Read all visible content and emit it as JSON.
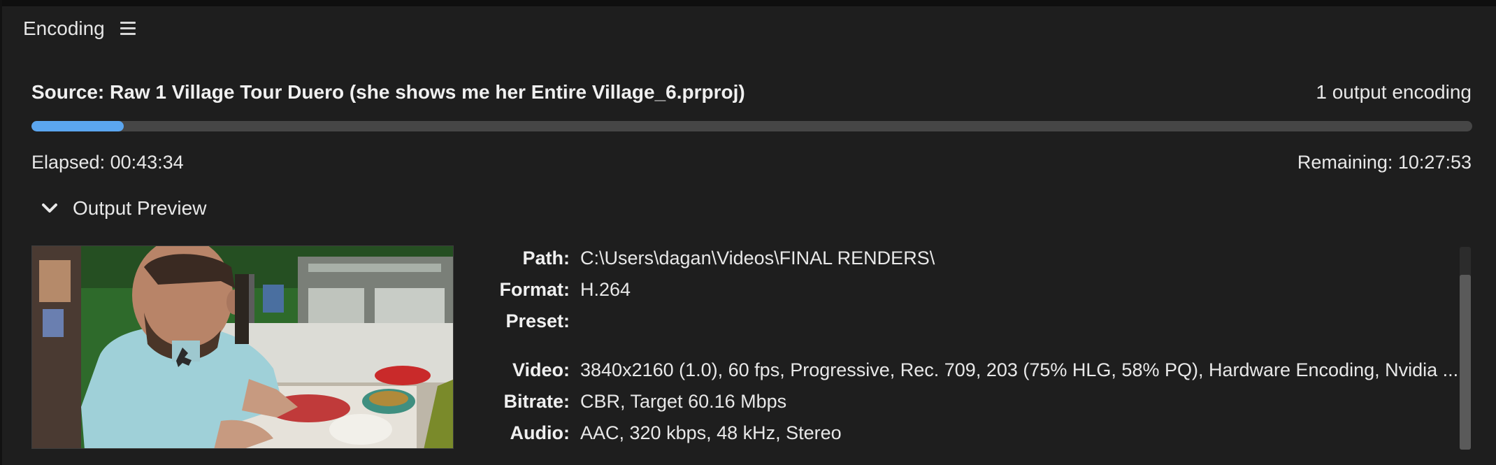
{
  "panel": {
    "tab_label": "Encoding",
    "menu_icon": "hamburger-menu-icon"
  },
  "encoding": {
    "source_label": "Source: Raw 1 Village Tour Duero (she shows me her Entire Village_6.prproj)",
    "output_count": "1 output encoding",
    "progress_fraction": 0.064,
    "progress_color": "#5ba6f0",
    "elapsed": "Elapsed: 00:43:34",
    "remaining": "Remaining: 10:27:53"
  },
  "preview": {
    "toggle_label": "Output Preview",
    "toggle_icon": "chevron-down-icon",
    "expanded": true
  },
  "output_info": {
    "path_label": "Path:",
    "path_value": "C:\\Users\\dagan\\Videos\\FINAL RENDERS\\",
    "format_label": "Format:",
    "format_value": "H.264",
    "preset_label": "Preset:",
    "preset_value": "",
    "video_label": "Video:",
    "video_value": "3840x2160 (1.0), 60 fps, Progressive, Rec. 709, 203 (75% HLG, 58% PQ), Hardware Encoding, Nvidia ...",
    "bitrate_label": "Bitrate:",
    "bitrate_value": "CBR, Target 60.16 Mbps",
    "audio_label": "Audio:",
    "audio_value": "AAC, 320 kbps, 48 kHz, Stereo"
  }
}
